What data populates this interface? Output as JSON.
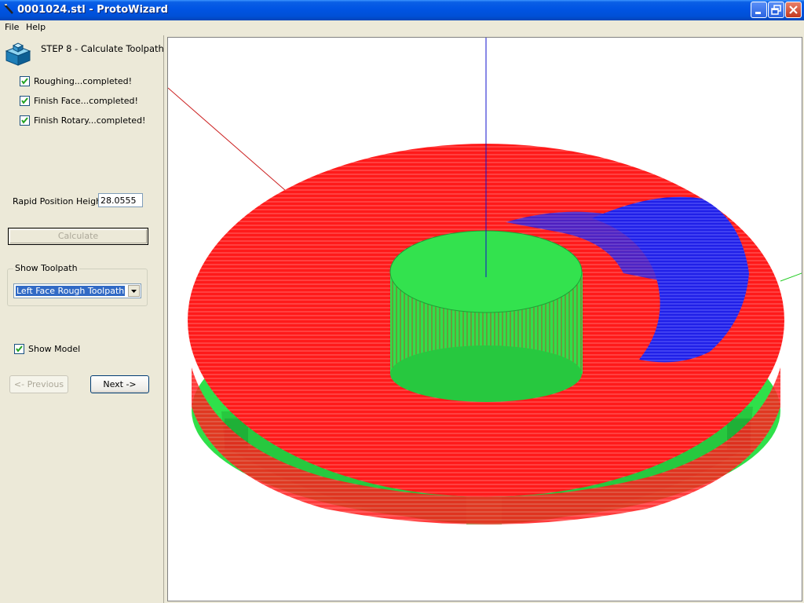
{
  "window": {
    "title": "0001024.stl - ProtoWizard",
    "icon": "app-icon",
    "controls": [
      "minimize-icon",
      "restore-icon",
      "close-icon"
    ]
  },
  "menu": {
    "items": [
      {
        "label": "File"
      },
      {
        "label": "Help"
      }
    ]
  },
  "wizard": {
    "step_title": "STEP 8 - Calculate Toolpath",
    "step_icon": "step-block-icon",
    "tasks": [
      {
        "label": "Roughing...completed!",
        "checked": true
      },
      {
        "label": "Finish Face...completed!",
        "checked": true
      },
      {
        "label": "Finish Rotary...completed!",
        "checked": true
      }
    ],
    "rapid_position_label": "Rapid Position Height:",
    "rapid_position_value": "28.0555",
    "calculate_label": "Calculate",
    "show_toolpath": {
      "legend": "Show Toolpath",
      "selected": "Left Face Rough Toolpath"
    },
    "show_model": {
      "label": "Show Model",
      "checked": true
    },
    "previous_label": "<- Previous",
    "next_label": "Next ->"
  },
  "viewport": {
    "colors": {
      "background": "#ffffff",
      "model": "#22dd44",
      "roughing_toolpath": "#ff0000",
      "rotary_toolpath": "#0000ff",
      "axis_x": "#cc0000",
      "axis_y": "#00cc00",
      "axis_z": "#0000cc"
    }
  }
}
